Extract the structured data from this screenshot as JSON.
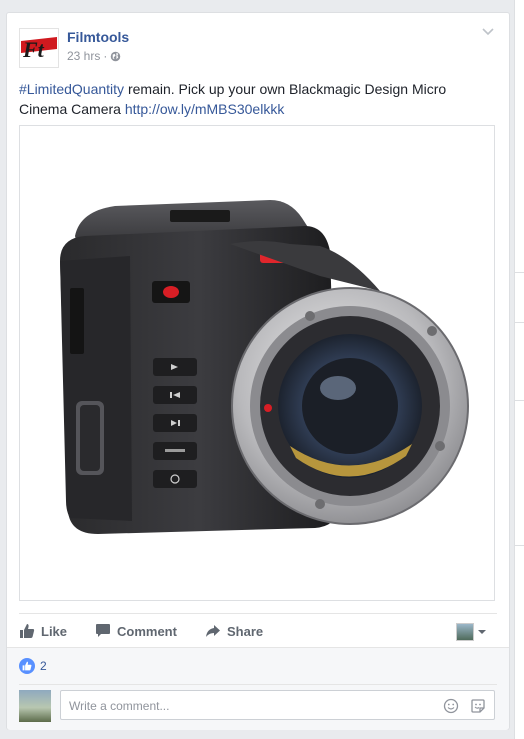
{
  "post": {
    "page_name": "Filmtools",
    "logo_text": "Ft",
    "timestamp": "23 hrs",
    "separator": "·",
    "privacy_icon": "globe-icon",
    "text_hashtag": "#LimitedQuantity",
    "text_body": " remain. Pick up your own Blackmagic Design Micro Cinema Camera ",
    "text_link": "http://ow.ly/mMBS30elkkk",
    "image_subject": "camera-image"
  },
  "actions": {
    "like_label": "Like",
    "comment_label": "Comment",
    "share_label": "Share"
  },
  "reactions": {
    "like_count": "2"
  },
  "comment_input": {
    "placeholder": "Write a comment..."
  },
  "colors": {
    "link": "#365899",
    "text": "#1d2129",
    "muted": "#90949c",
    "like_blue": "#5890ff",
    "logo_red": "#d0191f"
  }
}
